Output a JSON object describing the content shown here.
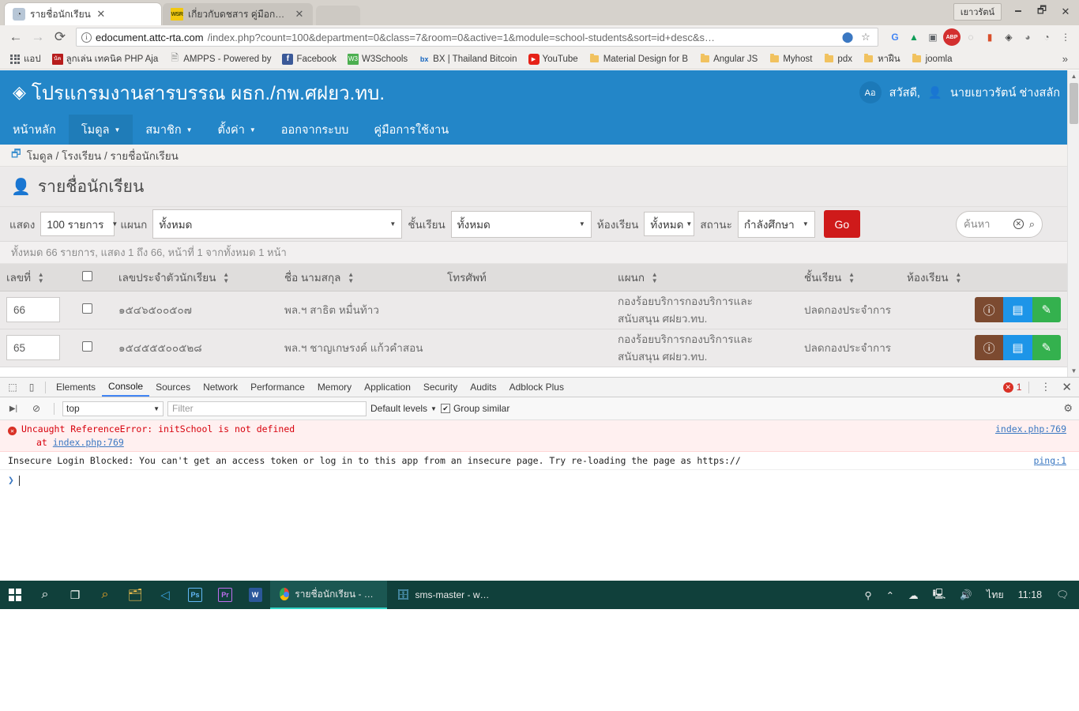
{
  "browser": {
    "window_user_label": "เยาวรัตน์",
    "window_controls": {
      "minimize": "🗕",
      "maximize": "🗗",
      "close": "✕"
    },
    "tabs": [
      {
        "title": "รายชื่อนักเรียน",
        "favicon": "chrome-page-icon",
        "active": true,
        "close": "✕"
      },
      {
        "title": "เกี่ยวกับดชสาร คู่มือการ์ใช้งา",
        "favicon": "wsr-icon",
        "active": false,
        "close": "✕"
      }
    ],
    "new_tab_label": "",
    "nav": {
      "back": "←",
      "forward": "→",
      "reload": "⟳"
    },
    "omnibox": {
      "site": "edocument.attc-rta.com",
      "path": "/index.php?count=100&department=0&class=7&room=0&active=1&module=school-students&sort=id+desc&s…",
      "info_icon": "i",
      "translate_icon": "translate-icon",
      "star_icon": "☆"
    },
    "extensions": [
      {
        "name": "google-translate-extension",
        "glyph": "G",
        "color": "#4285f4"
      },
      {
        "name": "google-drive-extension",
        "glyph": "▲",
        "color": "#0f9d58"
      },
      {
        "name": "screenshot-extension",
        "glyph": "▣",
        "color": "#5f6368"
      },
      {
        "name": "adblock-plus-extension",
        "glyph": "ABP",
        "color": "#d32f2f"
      },
      {
        "name": "loading-extension",
        "glyph": "◌",
        "color": "#9e9e9e"
      },
      {
        "name": "lastpass-extension",
        "glyph": "▮",
        "color": "#d94f2b"
      },
      {
        "name": "password-manager-extension",
        "glyph": "◈",
        "color": "#424242"
      },
      {
        "name": "balloon-extension",
        "glyph": "◕",
        "color": "#7e7e7e"
      },
      {
        "name": "stats-extension",
        "glyph": "◔",
        "color": "#6a6a6a"
      },
      {
        "name": "chrome-menu",
        "glyph": "⋮",
        "color": "#5a5a5a"
      }
    ],
    "bookmarks": [
      {
        "label": "แอป",
        "icon": "apps-grid-icon"
      },
      {
        "label": "ลูกเล่น เทคนิค PHP Aja",
        "icon": "site-icon-red"
      },
      {
        "label": "AMPPS - Powered by",
        "icon": "page-icon"
      },
      {
        "label": "Facebook",
        "icon": "facebook-icon"
      },
      {
        "label": "W3Schools",
        "icon": "w3schools-icon"
      },
      {
        "label": "BX | Thailand Bitcoin",
        "icon": "bx-icon"
      },
      {
        "label": "YouTube",
        "icon": "youtube-icon"
      },
      {
        "label": "Material Design for B",
        "icon": "folder-icon"
      },
      {
        "label": "Angular JS",
        "icon": "folder-icon"
      },
      {
        "label": "Myhost",
        "icon": "folder-icon"
      },
      {
        "label": "pdx",
        "icon": "folder-icon"
      },
      {
        "label": "หาฝืน",
        "icon": "folder-icon"
      },
      {
        "label": "joomla",
        "icon": "folder-icon"
      }
    ],
    "bookmarks_overflow": "»"
  },
  "app": {
    "brand": "โปรแกรมงานสารบรรณ ผธก./กพ.ศฝยว.ทบ.",
    "brand_icon": "layers-icon",
    "lang_badge": "Aอ",
    "greeting": "สวัสดี,",
    "user_icon": "person-icon",
    "user_name": "นายเยาวรัตน์ ช่างสลัก",
    "nav": [
      {
        "label": "หน้าหลัก",
        "caret": false,
        "active": false
      },
      {
        "label": "โมดูล",
        "caret": true,
        "active": true
      },
      {
        "label": "สมาชิก",
        "caret": true,
        "active": false
      },
      {
        "label": "ตั้งค่า",
        "caret": true,
        "active": false
      },
      {
        "label": "ออกจากระบบ",
        "caret": false,
        "active": false
      },
      {
        "label": "คู่มือการใช้งาน",
        "caret": false,
        "active": false
      }
    ],
    "breadcrumb": "โมดูล / โรงเรียน / รายชื่อนักเรียน",
    "breadcrumb_icon": "module-icon",
    "page_title": "รายชื่อนักเรียน",
    "page_title_icon": "user-list-icon"
  },
  "filters": {
    "show_label": "แสดง",
    "show_value": "100 รายการ",
    "dept_label": "แผนก",
    "dept_value": "ทั้งหมด",
    "class_label": "ชั้นเรียน",
    "class_value": "ทั้งหมด",
    "room_label": "ห้องเรียน",
    "room_value": "ทั้งหมด",
    "status_label": "สถานะ",
    "status_value": "กำลังศึกษา",
    "go_label": "Go",
    "go_color": "#cf1a1a",
    "search_placeholder": "ค้นหา",
    "search_value": "",
    "clear_icon": "✕",
    "search_icon": "🔍",
    "caret": "▼"
  },
  "summary": "ทั้งหมด 66 รายการ, แสดง 1 ถึง 66, หน้าที่ 1 จากทั้งหมด 1 หน้า",
  "table": {
    "columns": [
      {
        "label": "เลขที่",
        "sortable": true
      },
      {
        "label": "",
        "sortable": false,
        "checkbox": true
      },
      {
        "label": "เลขประจำตัวนักเรียน",
        "sortable": true
      },
      {
        "label": "ชื่อ นามสกุล",
        "sortable": true
      },
      {
        "label": "โทรศัพท์",
        "sortable": false
      },
      {
        "label": "แผนก",
        "sortable": true
      },
      {
        "label": "ชั้นเรียน",
        "sortable": true
      },
      {
        "label": "ห้องเรียน",
        "sortable": true
      },
      {
        "label": "",
        "sortable": false
      }
    ],
    "rows": [
      {
        "seq": "66",
        "student_id": "๑๕๔๖๕๐๐๕๐๗",
        "name": "พล.ฯ สาธิต หมื่นท้าว",
        "phone": "",
        "department": "กองร้อยบริการกองบริการและสนับสนุน ศฝยว.ทบ.",
        "class": "ปลดกองประจำการ",
        "room": ""
      },
      {
        "seq": "65",
        "student_id": "๑๕๔๕๕๕๐๐๕๒๘",
        "name": "พล.ฯ ชาญเกษรงค์ แก้วคำสอน",
        "phone": "",
        "department": "กองร้อยบริการกองบริการและสนับสนุน ศฝยว.ทบ.",
        "class": "ปลดกองประจำการ",
        "room": ""
      }
    ],
    "actions": [
      {
        "name": "info-button",
        "icon": "ⓘ",
        "color": "#7c4a30"
      },
      {
        "name": "detail-button",
        "icon": "▤",
        "color": "#1d95e8"
      },
      {
        "name": "edit-button",
        "icon": "✎",
        "color": "#34b14e"
      }
    ]
  },
  "devtools": {
    "tabs": [
      {
        "label": "Elements",
        "active": false
      },
      {
        "label": "Console",
        "active": true
      },
      {
        "label": "Sources",
        "active": false
      },
      {
        "label": "Network",
        "active": false
      },
      {
        "label": "Performance",
        "active": false
      },
      {
        "label": "Memory",
        "active": false
      },
      {
        "label": "Application",
        "active": false
      },
      {
        "label": "Security",
        "active": false
      },
      {
        "label": "Audits",
        "active": false
      },
      {
        "label": "Adblock Plus",
        "active": false
      }
    ],
    "inspect_icon": "⬚",
    "device_icon": "▯",
    "error_count": "1",
    "error_badge_glyph": "✕",
    "kebab": "⋮",
    "close": "✕",
    "execute_icon": "▶|",
    "clear_icon": "⊘",
    "context_value": "top",
    "context_caret": "▼",
    "filter_placeholder": "Filter",
    "levels_label": "Default levels",
    "levels_caret": "▼",
    "group_similar_label": "Group similar",
    "group_similar_checked": "✔",
    "gear_icon": "⚙",
    "messages": [
      {
        "level": "error",
        "text": "Uncaught ReferenceError: initSchool is not defined",
        "stack_prefix": "at",
        "stack_link": "index.php:769",
        "source": "index.php:769"
      },
      {
        "level": "warn",
        "text": "Insecure Login Blocked: You can't get an access token or log in to this app from an insecure page. Try re-loading the page as https://",
        "stack_prefix": "",
        "stack_link": "",
        "source": "ping:1"
      }
    ],
    "prompt_symbol": "❯"
  },
  "taskbar": {
    "start_icon": "windows-icon",
    "items": [
      {
        "name": "search-icon",
        "glyph": "search"
      },
      {
        "name": "task-view-icon",
        "glyph": "taskview"
      },
      {
        "name": "cortana-icon",
        "glyph": "cortana"
      },
      {
        "name": "file-explorer-icon",
        "glyph": "explorer"
      },
      {
        "name": "vscode-icon",
        "glyph": "vscode"
      },
      {
        "name": "photoshop-icon",
        "glyph": "Ps"
      },
      {
        "name": "premiere-icon",
        "glyph": "Pr"
      },
      {
        "name": "word-icon",
        "glyph": "W"
      }
    ],
    "windows": [
      {
        "label": "รายชื่อนักเรียน - Google...",
        "icon": "chrome-icon",
        "active": true
      },
      {
        "label": "sms-master - www.at...",
        "icon": "ftp-icon",
        "active": false
      }
    ],
    "tray": [
      {
        "name": "people-icon",
        "glyph": "⚲"
      },
      {
        "name": "show-hidden-icons",
        "glyph": "⌃"
      },
      {
        "name": "onedrive-icon",
        "glyph": "☁"
      },
      {
        "name": "network-icon",
        "glyph": "🖳"
      },
      {
        "name": "volume-icon",
        "glyph": "🔊"
      }
    ],
    "language": "ไทย",
    "clock_time": "11:18",
    "action_center_icon": "💬"
  }
}
